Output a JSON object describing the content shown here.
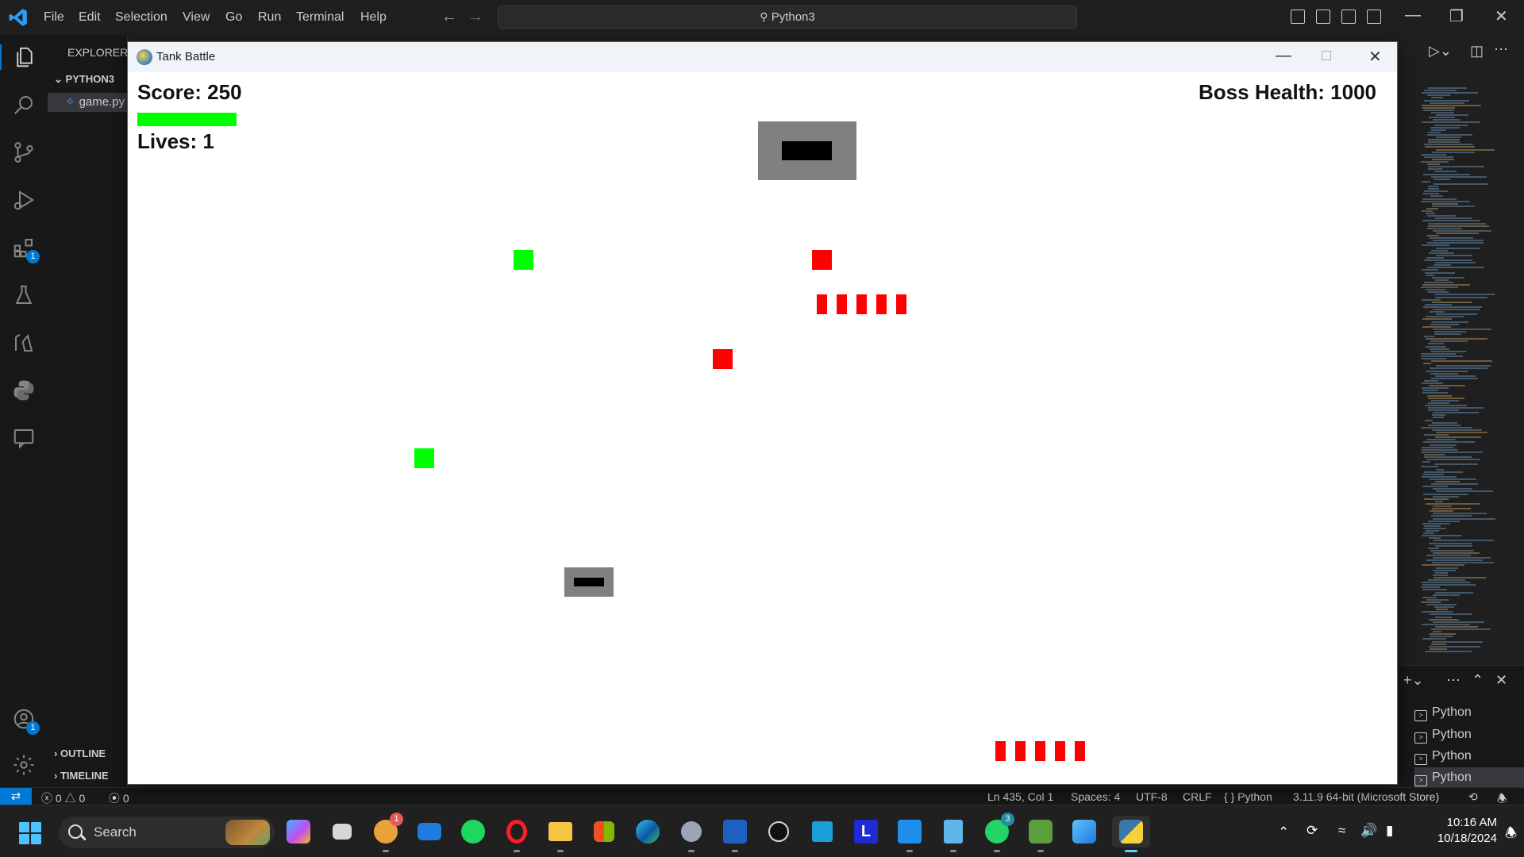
{
  "vscode": {
    "menu": [
      "File",
      "Edit",
      "Selection",
      "View",
      "Go",
      "Run",
      "Terminal",
      "Help"
    ],
    "command_center": "Python3",
    "sidebar": {
      "title": "EXPLORER",
      "folder": "PYTHON3",
      "file": "game.py",
      "outline": "OUTLINE",
      "timeline": "TIMELINE"
    },
    "activity_badges": {
      "extensions": "1",
      "accounts": "1"
    },
    "terminals": [
      "Python",
      "Python",
      "Python",
      "Python"
    ],
    "statusbar": {
      "errors": "0",
      "warnings": "0",
      "ports": "0",
      "position": "Ln 435, Col 1",
      "spaces": "Spaces: 4",
      "encoding": "UTF-8",
      "eol": "CRLF",
      "language": "Python",
      "interpreter": "3.11.9 64-bit (Microsoft Store)"
    }
  },
  "game_window": {
    "title": "Tank Battle",
    "score_label": "Score: 250",
    "lives_label": "Lives: 1",
    "boss_health_label": "Boss Health: 1000",
    "player_health_fraction": 1.0,
    "colors": {
      "player_bar": "#00ff00",
      "enemy": "#ff0000",
      "ally": "#00ff00",
      "tank_body": "#808080",
      "tank_barrel": "#000000"
    }
  },
  "taskbar": {
    "search_placeholder": "Search",
    "apps": [
      "copilot-icon",
      "task-view-icon",
      "notification-app-icon",
      "mail-icon",
      "spotify-icon",
      "opera-icon",
      "file-explorer-icon",
      "microsoft-store-icon",
      "edge-icon",
      "settings-icon",
      "word-icon",
      "obs-icon",
      "remote-app-icon",
      "l-app-icon",
      "vscode-icon",
      "notepad-icon",
      "whatsapp-icon",
      "vpn-icon",
      "photos-icon",
      "python-icon"
    ],
    "badges": {
      "notification_app": "1",
      "whatsapp": "3"
    },
    "time": "10:16 AM",
    "date": "10/18/2024"
  }
}
